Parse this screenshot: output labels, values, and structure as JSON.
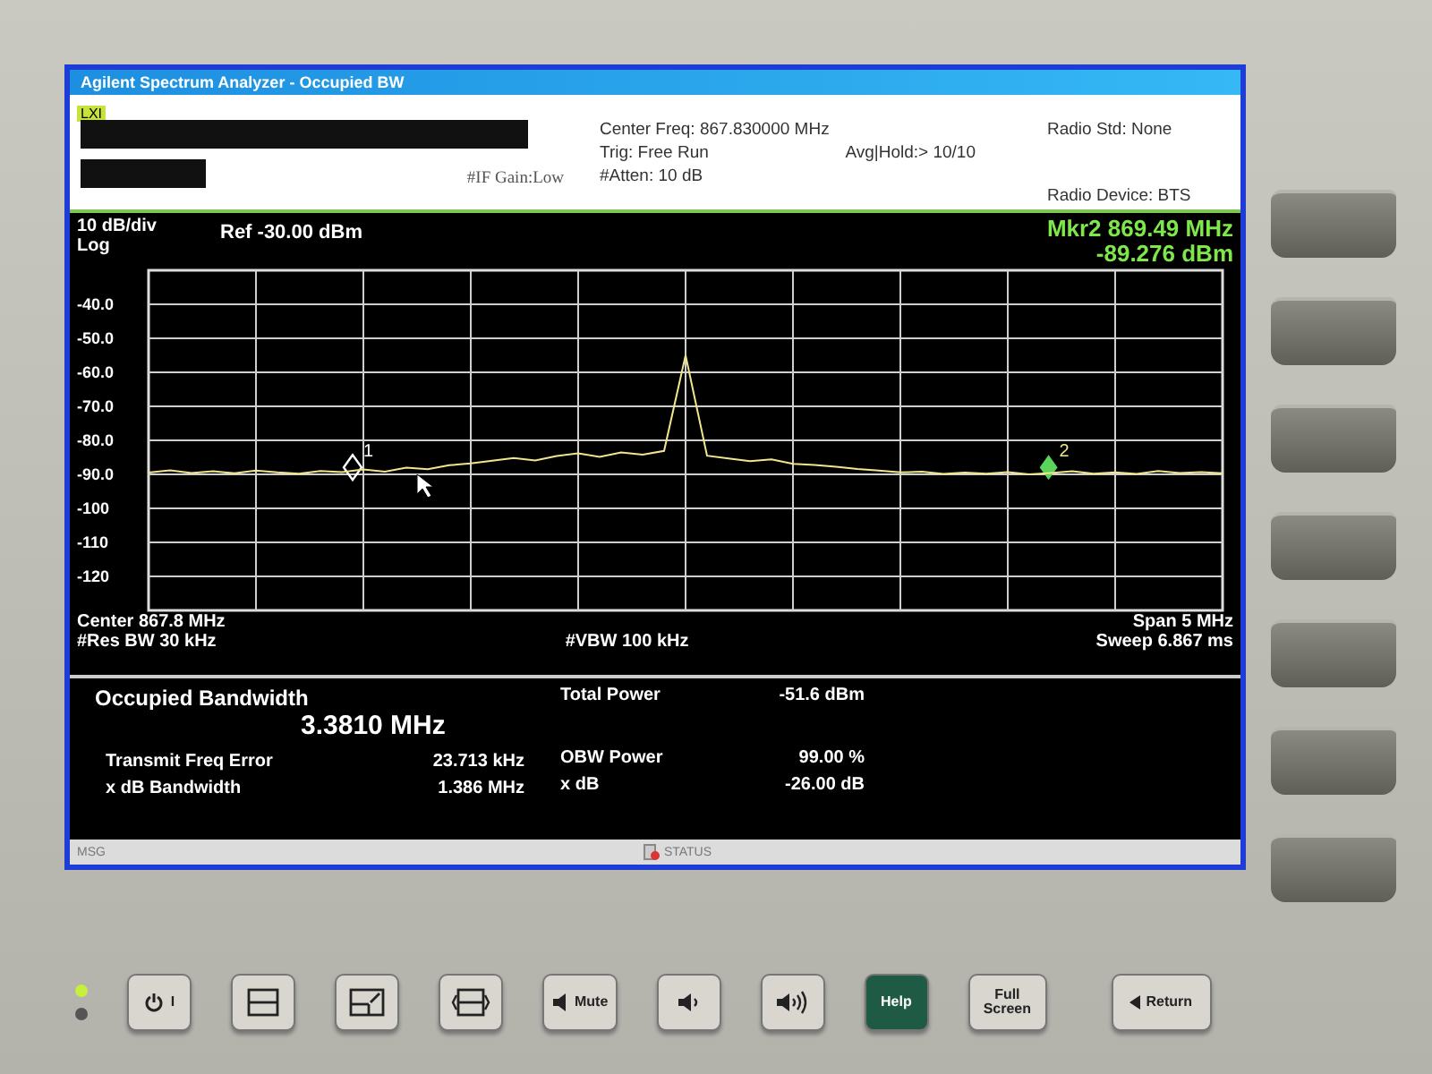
{
  "window": {
    "title": "Agilent Spectrum Analyzer - Occupied BW",
    "badge": "LXI"
  },
  "settings": {
    "if_gain": "#IF Gain:Low",
    "center_freq": "Center Freq: 867.830000 MHz",
    "trig": "Trig: Free Run",
    "atten": "#Atten: 10 dB",
    "avg_hold": "Avg|Hold:> 10/10",
    "radio_std": "Radio Std: None",
    "radio_device": "Radio Device: BTS"
  },
  "marker_readout": {
    "frequency": "Mkr2  869.49 MHz",
    "amplitude": "-89.276 dBm"
  },
  "graph": {
    "scale": "10 dB/div",
    "mode": "Log",
    "ref": "Ref -30.00 dBm",
    "chart_data": {
      "type": "line",
      "ylim": [
        -130,
        -30
      ],
      "grid": true,
      "yticks": [
        {
          "value": -40,
          "label": "-40.0"
        },
        {
          "value": -50,
          "label": "-50.0"
        },
        {
          "value": -60,
          "label": "-60.0"
        },
        {
          "value": -70,
          "label": "-70.0"
        },
        {
          "value": -80,
          "label": "-80.0"
        },
        {
          "value": -90,
          "label": "-90.0"
        },
        {
          "value": -100,
          "label": "-100"
        },
        {
          "value": -110,
          "label": "-110"
        },
        {
          "value": -120,
          "label": "-120"
        }
      ],
      "categories": [
        null,
        null,
        null,
        null,
        null,
        null,
        null,
        null,
        null,
        null,
        null,
        null,
        null,
        null,
        null,
        null,
        null,
        null,
        null,
        null,
        null,
        null,
        null,
        null,
        null,
        null,
        null,
        null,
        null,
        null,
        null,
        null,
        null,
        null,
        null,
        null,
        null,
        null,
        null,
        null,
        null,
        null,
        null,
        null,
        null,
        null,
        null,
        null,
        null,
        null,
        null
      ],
      "series": [
        {
          "color": "#f0e68c",
          "values": [
            -89.5,
            -88.8,
            -89.6,
            -89.1,
            -89.7,
            -88.9,
            -89.4,
            -89.8,
            -89.0,
            -89.3,
            -88.6,
            -89.2,
            -88.0,
            -88.5,
            -87.3,
            -86.8,
            -86.0,
            -85.2,
            -85.9,
            -84.6,
            -83.8,
            -84.9,
            -83.5,
            -84.2,
            -83.1,
            -55.0,
            -84.5,
            -85.3,
            -86.1,
            -85.6,
            -86.9,
            -87.2,
            -87.8,
            -88.4,
            -88.9,
            -89.4,
            -89.2,
            -89.9,
            -89.5,
            -89.8,
            -89.3,
            -90.0,
            -89.6,
            -89.1,
            -89.8,
            -89.4,
            -89.9,
            -89.0,
            -89.6,
            -89.3,
            -89.7
          ]
        }
      ]
    },
    "markers": [
      {
        "label": "1",
        "kind": "delta"
      },
      {
        "label": "2",
        "kind": "normal"
      }
    ],
    "center": "Center  867.8 MHz",
    "res_bw": "#Res BW  30 kHz",
    "vbw": "#VBW  100 kHz",
    "span": "Span 5 MHz",
    "sweep": "Sweep  6.867 ms"
  },
  "results": {
    "title": "Occupied Bandwidth",
    "bandwidth": "3.3810 MHz",
    "rows": [
      {
        "label": "Transmit Freq Error",
        "value": "23.713 kHz"
      },
      {
        "label": "x dB Bandwidth",
        "value": "1.386 MHz"
      }
    ],
    "total_power": {
      "label": "Total Power",
      "value": "-51.6 dBm"
    },
    "right_rows": [
      {
        "label": "OBW Power",
        "value": "99.00 %"
      },
      {
        "label": "x dB",
        "value": "-26.00 dB"
      }
    ]
  },
  "status_bar": {
    "msg": "MSG",
    "status": "STATUS"
  },
  "front_panel": {
    "buttons": [
      {
        "kind": "power",
        "label": "I",
        "color": "#d8d6cf"
      },
      {
        "kind": "split",
        "color": "#d8d6cf"
      },
      {
        "kind": "zoom",
        "color": "#d8d6cf"
      },
      {
        "kind": "expand",
        "color": "#d8d6cf"
      },
      {
        "kind": "mute",
        "label": "Mute",
        "color": "#d8d6cf"
      },
      {
        "kind": "vol-down",
        "color": "#d8d6cf"
      },
      {
        "kind": "vol-up",
        "color": "#d8d6cf"
      },
      {
        "kind": "text",
        "label": "Help",
        "color": "#1f5a45"
      },
      {
        "kind": "text",
        "label": "Full Screen",
        "color": "#d8d6cf"
      },
      {
        "kind": "return",
        "label": "Return",
        "color": "#d8d6cf"
      }
    ]
  }
}
